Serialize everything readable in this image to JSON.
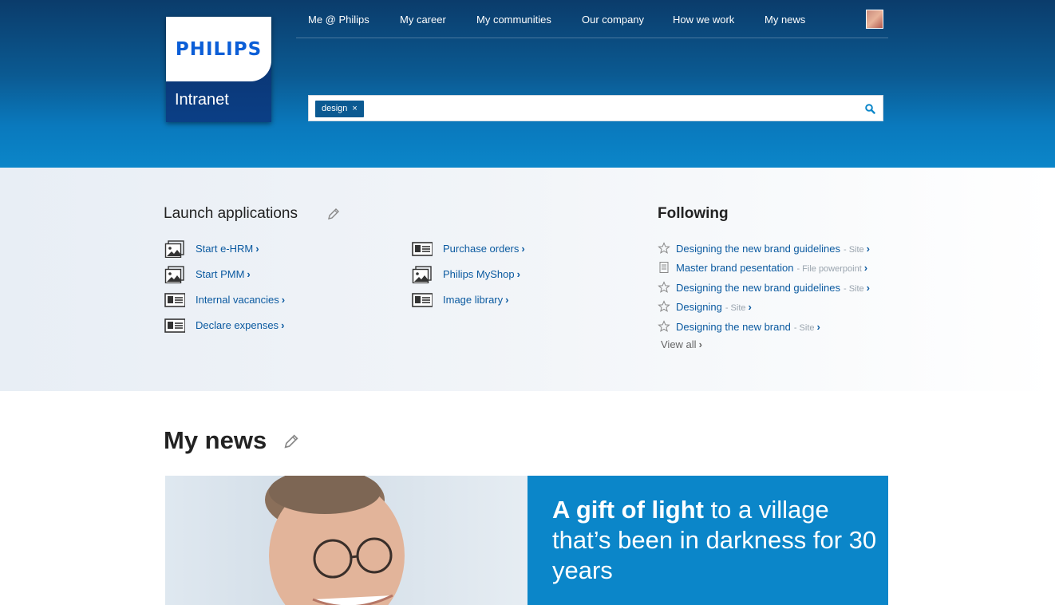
{
  "brand": {
    "logo_text": "PHILIPS",
    "subtitle": "Intranet",
    "accent": "#0b86c9",
    "dark": "#0b3c6b"
  },
  "nav": {
    "items": [
      "Me @ Philips",
      "My career",
      "My communities",
      "Our company",
      "How we work",
      "My news"
    ]
  },
  "search": {
    "tag": "design",
    "tag_remove": "×",
    "placeholder": ""
  },
  "launch": {
    "title": "Launch applications",
    "apps": [
      {
        "label": "Start e-HRM",
        "icon": "image-icon"
      },
      {
        "label": "Start PMM",
        "icon": "image-icon"
      },
      {
        "label": "Internal vacancies",
        "icon": "id-card-icon"
      },
      {
        "label": "Declare expenses",
        "icon": "id-card-icon"
      },
      {
        "label": "Purchase orders",
        "icon": "id-card-icon"
      },
      {
        "label": "Philips MyShop",
        "icon": "image-icon"
      },
      {
        "label": "Image library",
        "icon": "id-card-icon"
      }
    ]
  },
  "following": {
    "title": "Following",
    "items": [
      {
        "label": "Designing the new brand guidelines",
        "meta": "- Site",
        "icon": "star-icon"
      },
      {
        "label": "Master brand pesentation",
        "meta": "- File powerpoint",
        "icon": "document-icon"
      },
      {
        "label": "Designing the new brand guidelines",
        "meta": "- Site",
        "icon": "star-icon"
      },
      {
        "label": "Designing",
        "meta": "- Site",
        "icon": "star-icon"
      },
      {
        "label": "Designing the new brand",
        "meta": "- Site",
        "icon": "star-icon"
      }
    ],
    "view_all": "View all"
  },
  "news": {
    "title": "My news",
    "headline_bold": "A gift of light",
    "headline_rest": " to a village that’s been in darkness for 30 years"
  },
  "chevron": "›"
}
